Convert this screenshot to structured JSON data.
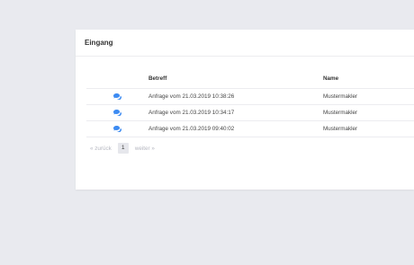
{
  "panel": {
    "title": "Eingang"
  },
  "table": {
    "headers": {
      "icon": "",
      "subject": "Betreff",
      "name": "Name"
    },
    "rows": [
      {
        "icon": "chat-icon",
        "subject": "Anfrage vom 21.03.2019 10:38:26",
        "name": "Mustermakler"
      },
      {
        "icon": "chat-icon",
        "subject": "Anfrage vom 21.03.2019 10:34:17",
        "name": "Mustermakler"
      },
      {
        "icon": "chat-icon",
        "subject": "Anfrage vom 21.03.2019 09:40:02",
        "name": "Mustermakler"
      }
    ]
  },
  "pagination": {
    "prev_label": "« zurück",
    "current_page": "1",
    "next_label": "weiter »"
  },
  "colors": {
    "background": "#e9eaef",
    "icon_accent": "#3d8bf2",
    "muted_text": "#b5b7c0"
  }
}
